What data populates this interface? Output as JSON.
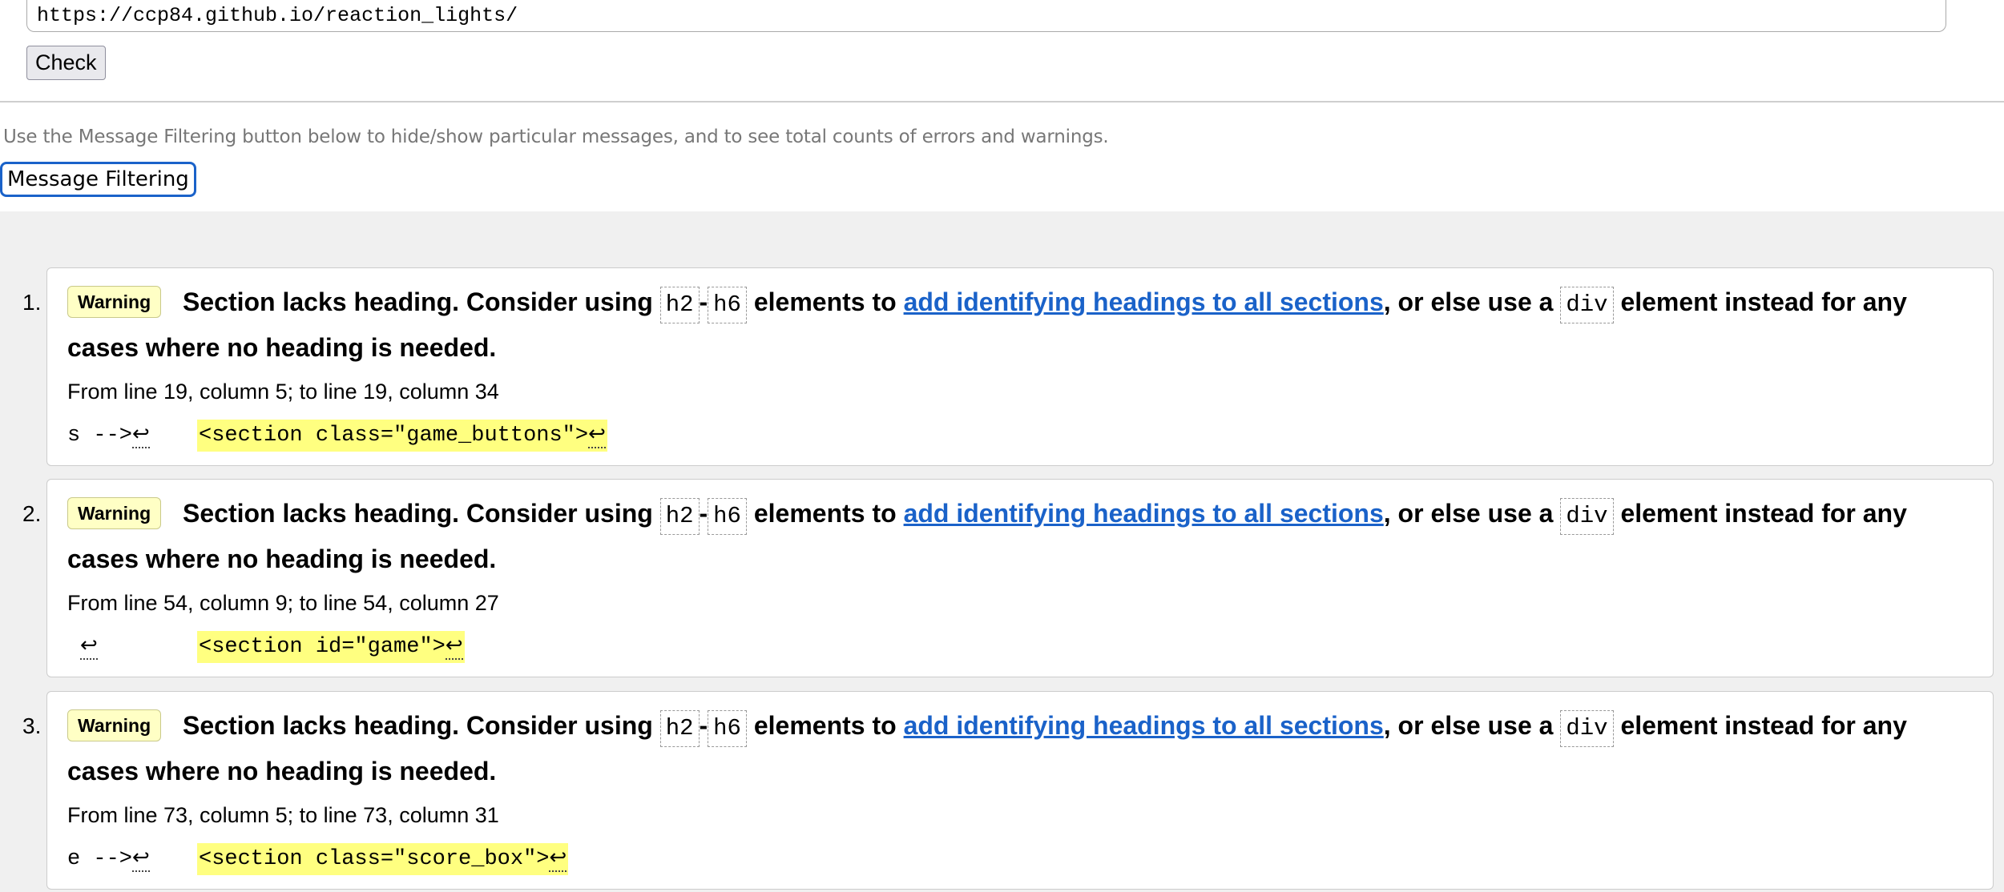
{
  "url_input": {
    "value": "https://ccp84.github.io/reaction_lights/"
  },
  "check_button": "Check",
  "help_text": "Use the Message Filtering button below to hide/show particular messages, and to see total counts of errors and warnings.",
  "filter_button": "Message Filtering",
  "messages": [
    {
      "number": "1.",
      "type": "Warning",
      "text_a": "Section lacks heading. Consider using ",
      "code1": "h2",
      "sep": "-",
      "code2": "h6",
      "text_b": " elements to ",
      "link": "add identifying headings to all sections",
      "text_c": ", or else use a ",
      "code3": "div",
      "text_d": " element instead for any cases where no heading is needed.",
      "location": "From line 19, column 5; to line 19, column 34",
      "extract_pre": "s -->",
      "extract_hl": "<section class=\"game_buttons\">",
      "arrow": "↩"
    },
    {
      "number": "2.",
      "type": "Warning",
      "text_a": "Section lacks heading. Consider using ",
      "code1": "h2",
      "sep": "-",
      "code2": "h6",
      "text_b": " elements to ",
      "link": "add identifying headings to all sections",
      "text_c": ", or else use a ",
      "code3": "div",
      "text_d": " element instead for any cases where no heading is needed.",
      "location": "From line 54, column 9; to line 54, column 27",
      "extract_pre": "",
      "extract_hl": "<section id=\"game\">",
      "arrow": "↩"
    },
    {
      "number": "3.",
      "type": "Warning",
      "text_a": "Section lacks heading. Consider using ",
      "code1": "h2",
      "sep": "-",
      "code2": "h6",
      "text_b": " elements to ",
      "link": "add identifying headings to all sections",
      "text_c": ", or else use a ",
      "code3": "div",
      "text_d": " element instead for any cases where no heading is needed.",
      "location": "From line 73, column 5; to line 73, column 31",
      "extract_pre": "e -->",
      "extract_hl": "<section class=\"score_box\">",
      "arrow": "↩"
    }
  ]
}
